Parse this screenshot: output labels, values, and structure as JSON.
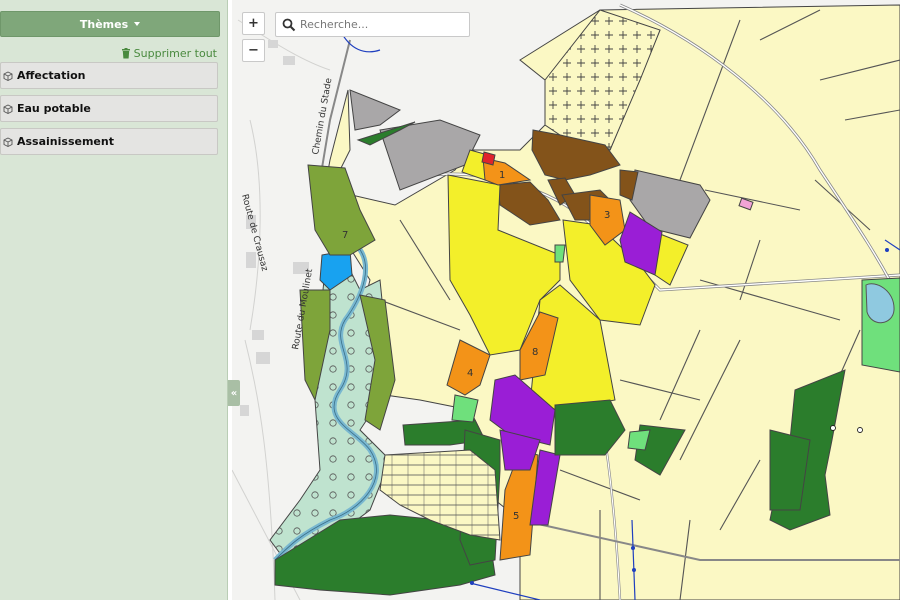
{
  "sidebar": {
    "themes_label": "Thèmes",
    "delete_all_label": "Supprimer tout",
    "items": [
      {
        "label": "Affectation"
      },
      {
        "label": "Eau potable"
      },
      {
        "label": "Assainissement"
      }
    ],
    "collapse_label": "«"
  },
  "map_controls": {
    "zoom_in": "+",
    "zoom_out": "−",
    "search_placeholder": "Recherche..."
  },
  "map": {
    "street_labels": [
      "Chemin du Stade",
      "Route de Crausaz",
      "Route du Moulinet"
    ],
    "zone_numbers": [
      "1",
      "3",
      "4",
      "5",
      "7",
      "8"
    ]
  },
  "colors": {
    "sidebar_bg": "#d9e6d6",
    "themes_bg": "#7fa77a",
    "delete_green": "#4a8a3f",
    "agri_zone": "#fbf8c4",
    "building_zone": "#f3ef2a",
    "forest": "#2b7d2c",
    "forest_light": "#7ea43a",
    "water_zone": "#bfe3cf",
    "orange_zone": "#f39318",
    "purple_zone": "#9a1ed6",
    "brown_zone": "#83531a",
    "grey_zone": "#a9a7a8",
    "light_green": "#6fe07c",
    "river": "#79b8d0"
  }
}
